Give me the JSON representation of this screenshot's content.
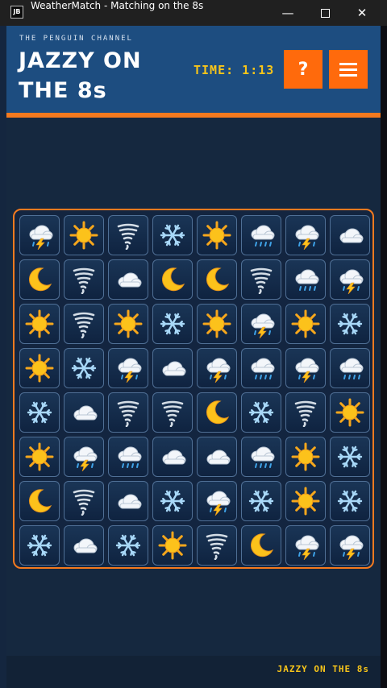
{
  "window": {
    "icon_label": "JB",
    "title": "WeatherMatch - Matching on the 8s",
    "minimize": "—",
    "close": "✕"
  },
  "header": {
    "channel": "THE PENGUIN CHANNEL",
    "title": "JAZZY ON THE 8s",
    "timer": "TIME: 1:13",
    "help_label": "?",
    "menu_icon": "menu-icon"
  },
  "board": {
    "rows": 8,
    "cols": 8,
    "tiles": [
      [
        "storm",
        "sun",
        "tornado",
        "snow",
        "sun",
        "rain",
        "storm",
        "cloud"
      ],
      [
        "moon",
        "tornado",
        "cloud",
        "moon",
        "moon",
        "tornado",
        "rain",
        "storm"
      ],
      [
        "sun",
        "tornado",
        "sun",
        "snow",
        "sun",
        "storm",
        "sun",
        "snow"
      ],
      [
        "sun",
        "snow",
        "storm",
        "cloud",
        "storm",
        "rain",
        "storm",
        "rain"
      ],
      [
        "snow",
        "cloud",
        "tornado",
        "tornado",
        "moon",
        "snow",
        "tornado",
        "sun"
      ],
      [
        "sun",
        "storm",
        "rain",
        "cloud",
        "cloud",
        "rain",
        "sun",
        "snow"
      ],
      [
        "moon",
        "tornado",
        "cloud",
        "snow",
        "storm",
        "snow",
        "sun",
        "snow"
      ],
      [
        "snow",
        "cloud",
        "snow",
        "sun",
        "tornado",
        "moon",
        "storm",
        "storm"
      ]
    ]
  },
  "footer": {
    "text": "JAZZY ON THE 8s"
  },
  "colors": {
    "accent": "#f47a1f",
    "header_blue": "#1d4d80",
    "timer_yellow": "#f8c51a",
    "button_orange": "#ff6a0c"
  }
}
